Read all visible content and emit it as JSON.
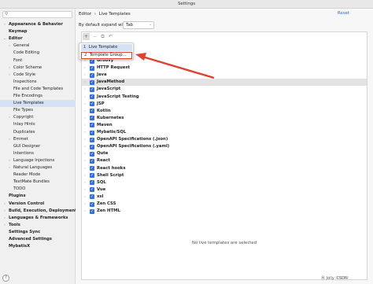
{
  "window": {
    "title": "Settings"
  },
  "sidebar": {
    "search_icon": "search-icon",
    "items": [
      {
        "label": "Appearance & Behavior",
        "arrow": "›",
        "bold": true,
        "indent": 0
      },
      {
        "label": "Keymap",
        "arrow": "",
        "bold": true,
        "indent": 0
      },
      {
        "label": "Editor",
        "arrow": "⌄",
        "bold": true,
        "indent": 0
      },
      {
        "label": "General",
        "arrow": "›",
        "bold": false,
        "indent": 1
      },
      {
        "label": "Code Editing",
        "arrow": "",
        "bold": false,
        "indent": 1
      },
      {
        "label": "Font",
        "arrow": "",
        "bold": false,
        "indent": 1
      },
      {
        "label": "Color Scheme",
        "arrow": "›",
        "bold": false,
        "indent": 1
      },
      {
        "label": "Code Style",
        "arrow": "›",
        "bold": false,
        "indent": 1
      },
      {
        "label": "Inspections",
        "arrow": "",
        "bold": false,
        "indent": 1
      },
      {
        "label": "File and Code Templates",
        "arrow": "",
        "bold": false,
        "indent": 1
      },
      {
        "label": "File Encodings",
        "arrow": "",
        "bold": false,
        "indent": 1
      },
      {
        "label": "Live Templates",
        "arrow": "",
        "bold": false,
        "indent": 1,
        "selected": true
      },
      {
        "label": "File Types",
        "arrow": "",
        "bold": false,
        "indent": 1
      },
      {
        "label": "Copyright",
        "arrow": "›",
        "bold": false,
        "indent": 1
      },
      {
        "label": "Inlay Hints",
        "arrow": "",
        "bold": false,
        "indent": 1
      },
      {
        "label": "Duplicates",
        "arrow": "",
        "bold": false,
        "indent": 1
      },
      {
        "label": "Emmet",
        "arrow": "›",
        "bold": false,
        "indent": 1
      },
      {
        "label": "GUI Designer",
        "arrow": "",
        "bold": false,
        "indent": 1
      },
      {
        "label": "Intentions",
        "arrow": "",
        "bold": false,
        "indent": 1
      },
      {
        "label": "Language Injections",
        "arrow": "›",
        "bold": false,
        "indent": 1
      },
      {
        "label": "Natural Languages",
        "arrow": "›",
        "bold": false,
        "indent": 1
      },
      {
        "label": "Reader Mode",
        "arrow": "",
        "bold": false,
        "indent": 1
      },
      {
        "label": "TextMate Bundles",
        "arrow": "",
        "bold": false,
        "indent": 1
      },
      {
        "label": "TODO",
        "arrow": "",
        "bold": false,
        "indent": 1
      },
      {
        "label": "Plugins",
        "arrow": "",
        "bold": true,
        "indent": 0
      },
      {
        "label": "Version Control",
        "arrow": "›",
        "bold": true,
        "indent": 0
      },
      {
        "label": "Build, Execution, Deployment",
        "arrow": "›",
        "bold": true,
        "indent": 0
      },
      {
        "label": "Languages & Frameworks",
        "arrow": "›",
        "bold": true,
        "indent": 0
      },
      {
        "label": "Tools",
        "arrow": "›",
        "bold": true,
        "indent": 0
      },
      {
        "label": "Settings Sync",
        "arrow": "",
        "bold": true,
        "indent": 0
      },
      {
        "label": "Advanced Settings",
        "arrow": "",
        "bold": true,
        "indent": 0
      },
      {
        "label": "MybatisX",
        "arrow": "",
        "bold": true,
        "indent": 0
      }
    ],
    "help_glyph": "?"
  },
  "breadcrumb": {
    "parent": "Editor",
    "separator": "›",
    "current": "Live Templates"
  },
  "reset_label": "Reset",
  "expand": {
    "label": "By default expand with",
    "value": "Tab"
  },
  "toolbar": {
    "add": "+",
    "remove": "−",
    "copy": "⧉",
    "undo": "↶"
  },
  "popup": {
    "items": [
      {
        "num": "1",
        "label": "Live Template"
      },
      {
        "num": "2",
        "label": "Template Group..."
      }
    ]
  },
  "groups": [
    "Groovy",
    "HTTP Request",
    "Java",
    "JavaMethod",
    "JavaScript",
    "JavaScript Testing",
    "JSP",
    "Kotlin",
    "Kubernetes",
    "Maven",
    "Mybatis/SQL",
    "OpenAPI Specifications (.json)",
    "OpenAPI Specifications (.yaml)",
    "Qute",
    "React",
    "React hooks",
    "Shell Script",
    "SQL",
    "Vue",
    "xsl",
    "Zen CSS",
    "Zen HTML"
  ],
  "selected_group": "JavaMethod",
  "empty_message": "No live templates are selected",
  "watermark": {
    "left": "Ⓦ Jolly",
    "tag": "CSDN"
  },
  "colors": {
    "accent": "#2f6fdf",
    "annotation": "#e0402c",
    "selection": "#d5e1f4"
  }
}
